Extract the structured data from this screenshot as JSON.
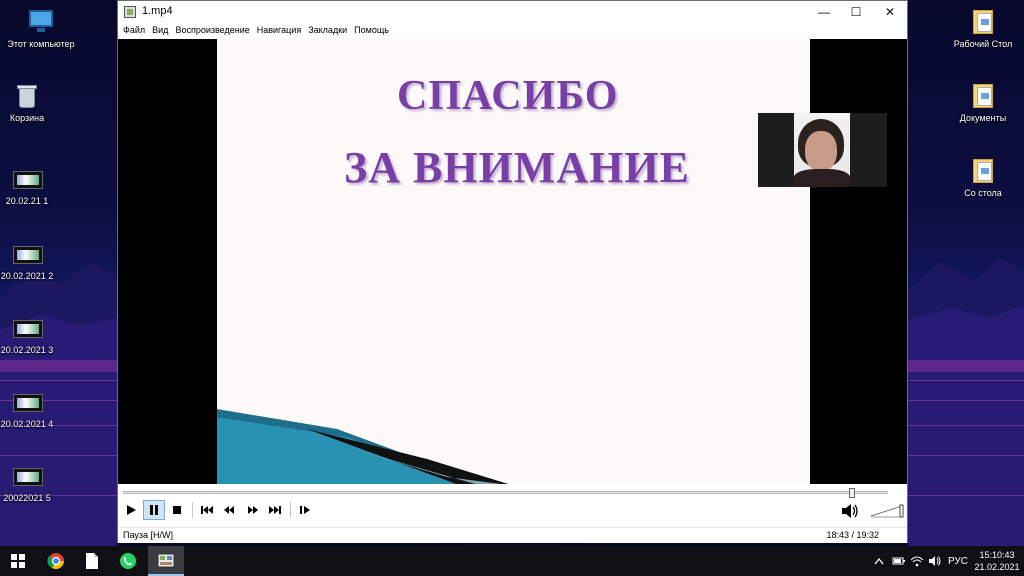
{
  "desktop": {
    "icons_left": [
      {
        "label": "Этот компьютер",
        "icon": "computer-icon"
      },
      {
        "label": "Корзина",
        "icon": "recycle-bin-icon"
      },
      {
        "label": "20.02.21 1",
        "icon": "video-file-icon"
      },
      {
        "label": "20.02.2021 2",
        "icon": "video-file-icon"
      },
      {
        "label": "20.02.2021 3",
        "icon": "video-file-icon"
      },
      {
        "label": "20.02.2021 4",
        "icon": "video-file-icon"
      },
      {
        "label": "20022021 5",
        "icon": "video-file-icon"
      }
    ],
    "icons_right": [
      {
        "label": "Рабочий Стол",
        "icon": "folder-icon"
      },
      {
        "label": "Документы",
        "icon": "folder-icon"
      },
      {
        "label": "Со стола",
        "icon": "folder-icon"
      }
    ]
  },
  "window": {
    "title": "1.mp4",
    "controls": {
      "minimize": "—",
      "maximize": "☐",
      "close": "✕"
    },
    "menu": [
      "Файл",
      "Вид",
      "Воспроизведение",
      "Навигация",
      "Закладки",
      "Помощь"
    ]
  },
  "slide": {
    "line1": "СПАСИБО",
    "line2": "ЗА ВНИМАНИЕ",
    "title_color": "#7a3fa6"
  },
  "player": {
    "seek_position_fraction": 0.953,
    "buttons": [
      "play",
      "pause",
      "stop",
      "skip-back",
      "rewind",
      "fast-forward",
      "skip-forward",
      "frame-step"
    ],
    "status": "Пауза [H/W]",
    "time": "18:43 / 19:32"
  },
  "taskbar": {
    "apps": [
      "start-icon",
      "chrome-icon",
      "file-icon",
      "whatsapp-icon",
      "media-player-icon"
    ],
    "tray": {
      "language": "РУС",
      "time": "15:10:43",
      "date": "21.02.2021"
    }
  }
}
